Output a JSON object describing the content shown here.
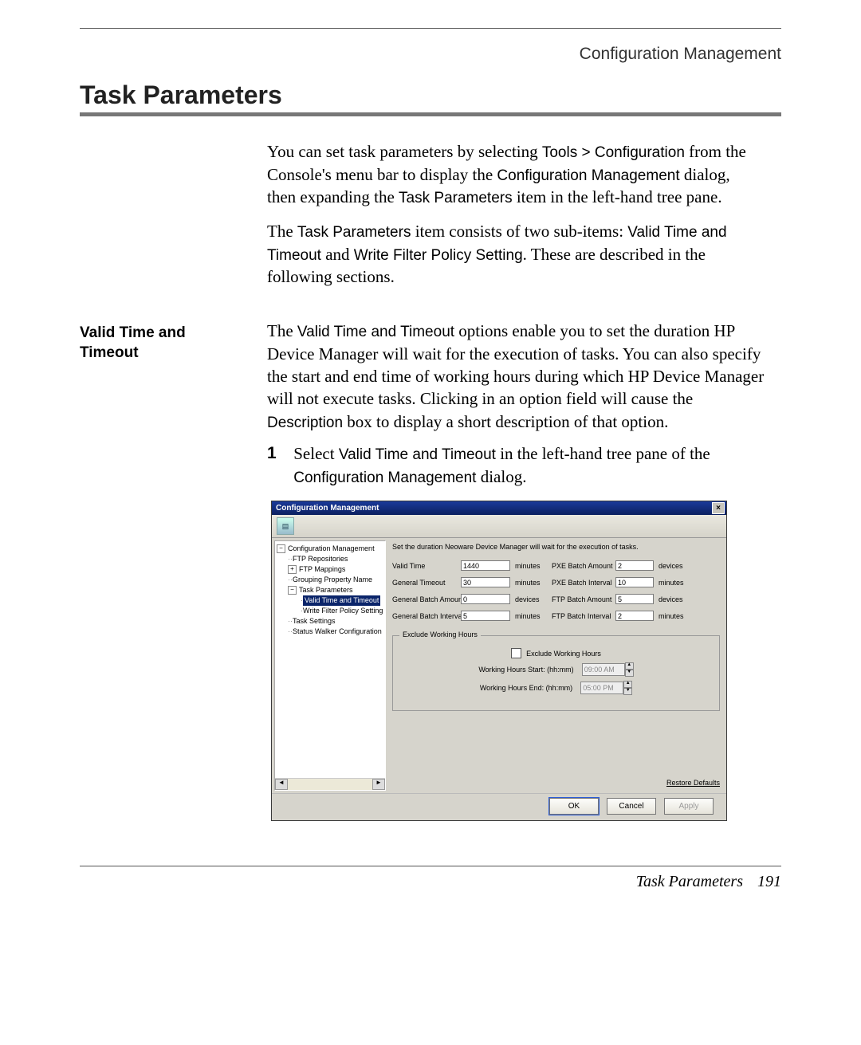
{
  "header": {
    "section": "Configuration Management"
  },
  "title": "Task Parameters",
  "intro": {
    "p1a": "You can set task parameters by selecting ",
    "p1b": "Tools > Configuration",
    "p1c": " from the Console's menu bar to display the ",
    "p1d": "Configuration Management",
    "p1e": " dialog, then expanding the ",
    "p1f": "Task Parameters",
    "p1g": " item in the left-hand tree pane.",
    "p2a": "The ",
    "p2b": "Task Parameters",
    "p2c": " item consists of two sub-items: ",
    "p2d": "Valid Time and Timeout",
    "p2e": " and ",
    "p2f": "Write Filter Policy Setting",
    "p2g": ". These are described in the following sections."
  },
  "side_heading": "Valid Time and Timeout",
  "body2": {
    "p1a": "The ",
    "p1b": "Valid Time and Timeout",
    "p1c": " options enable you to set the duration HP Device Manager will wait for the execution of tasks. You can also specify the start and end time of working hours during which HP Device Manager will not execute tasks. Clicking in an option field will cause the ",
    "p1d": "Description",
    "p1e": " box to display a short description of that option.",
    "step_num": "1",
    "step_a": "Select ",
    "step_b": "Valid Time and Timeout",
    "step_c": " in the left-hand tree pane of the ",
    "step_d": "Configuration Management",
    "step_e": " dialog."
  },
  "dialog": {
    "title": "Configuration Management",
    "close": "×",
    "tree": {
      "root": "Configuration Management",
      "n1": "FTP Repositories",
      "n2": "FTP Mappings",
      "n3": "Grouping Property Name",
      "n4": "Task Parameters",
      "n4a": "Valid Time and Timeout",
      "n4b": "Write Filter Policy Setting",
      "n5": "Task Settings",
      "n6": "Status Walker Configuration"
    },
    "desc": "Set the duration Neoware Device Manager will wait for the execution of tasks.",
    "fields": {
      "valid_time": {
        "label": "Valid Time",
        "value": "1440",
        "unit": "minutes"
      },
      "general_timeout": {
        "label": "General Timeout",
        "value": "30",
        "unit": "minutes"
      },
      "general_batch_amount": {
        "label": "General Batch Amount",
        "value": "0",
        "unit": "devices"
      },
      "general_batch_interval": {
        "label": "General Batch Interval",
        "value": "5",
        "unit": "minutes"
      },
      "pxe_batch_amount": {
        "label": "PXE Batch Amount",
        "value": "2",
        "unit": "devices"
      },
      "pxe_batch_interval": {
        "label": "PXE Batch Interval",
        "value": "10",
        "unit": "minutes"
      },
      "ftp_batch_amount": {
        "label": "FTP Batch Amount",
        "value": "5",
        "unit": "devices"
      },
      "ftp_batch_interval": {
        "label": "FTP Batch Interval",
        "value": "2",
        "unit": "minutes"
      }
    },
    "exclude": {
      "legend": "Exclude Working Hours",
      "checkbox": "Exclude Working Hours",
      "start_label": "Working Hours Start: (hh:mm)",
      "start_value": "09:00 AM",
      "end_label": "Working Hours End: (hh:mm)",
      "end_value": "05:00 PM"
    },
    "restore": "Restore Defaults",
    "buttons": {
      "ok": "OK",
      "cancel": "Cancel",
      "apply": "Apply"
    }
  },
  "footer": {
    "title": "Task Parameters",
    "page": "191"
  }
}
